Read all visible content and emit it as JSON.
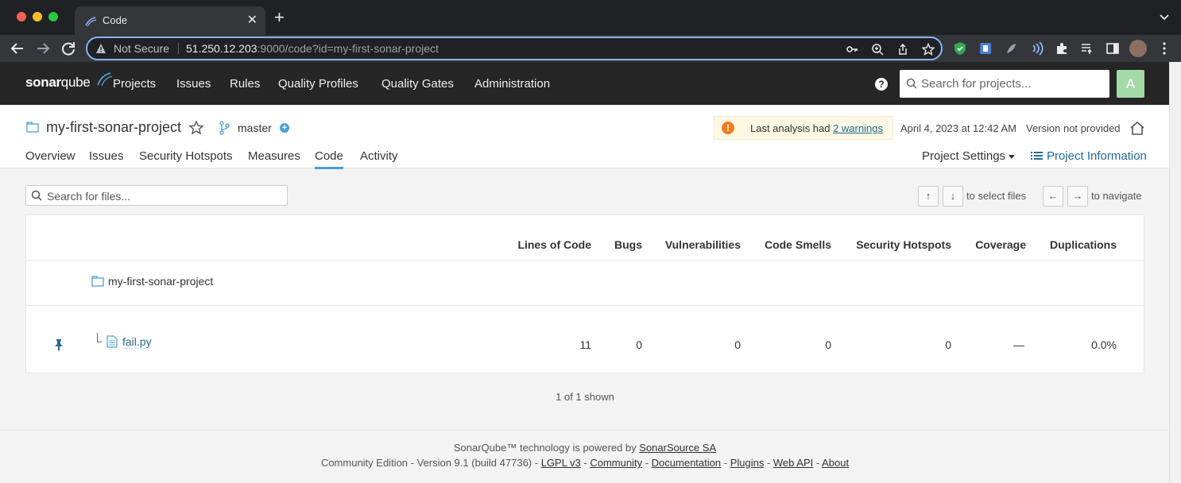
{
  "browser": {
    "tab_title": "Code",
    "new_tab": "+",
    "close": "✕",
    "not_secure": "Not Secure",
    "url_host": "51.250.12.203",
    "url_rest": ":9000/code?id=my-first-sonar-project"
  },
  "topnav": {
    "logo_bold": "sonar",
    "logo_light": "qube",
    "links": [
      "Projects",
      "Issues",
      "Rules",
      "Quality Profiles",
      "Quality Gates",
      "Administration"
    ],
    "help": "?",
    "search_placeholder": "Search for projects...",
    "avatar": "A"
  },
  "project": {
    "name": "my-first-sonar-project",
    "branch": "master",
    "branch_add": "+",
    "warning_icon": "!",
    "warning_text": "Last analysis had ",
    "warning_link": "2 warnings",
    "analysis_date": "April 4, 2023 at 12:42 AM",
    "version": "Version not provided",
    "tabs": [
      "Overview",
      "Issues",
      "Security Hotspots",
      "Measures",
      "Code",
      "Activity"
    ],
    "active_tab": "Code",
    "settings_label": "Project Settings",
    "info_label": "Project Information"
  },
  "code": {
    "search_placeholder": "Search for files...",
    "keys": {
      "up": "↑",
      "down": "↓",
      "select_hint": "to select files",
      "left": "←",
      "right": "→",
      "navigate_hint": "to navigate"
    },
    "columns": [
      "Lines of Code",
      "Bugs",
      "Vulnerabilities",
      "Code Smells",
      "Security Hotspots",
      "Coverage",
      "Duplications"
    ],
    "root_name": "my-first-sonar-project",
    "rows": [
      {
        "name": "fail.py",
        "lines_of_code": "11",
        "bugs": "0",
        "vulnerabilities": "0",
        "code_smells": "0",
        "security_hotspots": "0",
        "coverage": "—",
        "duplications": "0.0%"
      }
    ],
    "shown": "1 of 1 shown"
  },
  "footer": {
    "line1_prefix": "SonarQube™ technology is powered by ",
    "line1_link": "SonarSource SA",
    "line2_prefix": "Community Edition - Version 9.1 (build 47736) - ",
    "links": [
      "LGPL v3",
      "Community",
      "Documentation",
      "Plugins",
      "Web API",
      "About"
    ],
    "separator": " - "
  },
  "colors": {
    "nav_bg": "#262626",
    "accent": "#4b9fd5",
    "link": "#236a97",
    "warning": "#ed7d20",
    "avatar_bg": "#a4d9a8"
  }
}
